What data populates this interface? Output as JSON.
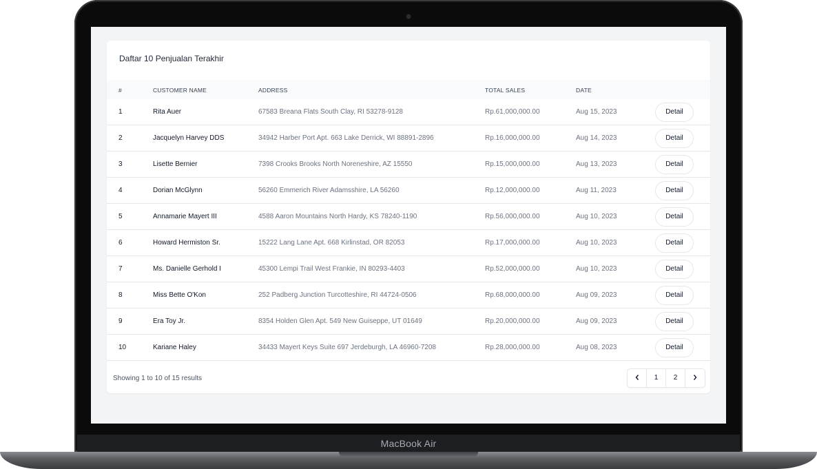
{
  "device": {
    "brand_label": "MacBook Air"
  },
  "card": {
    "title": "Daftar 10 Penjualan Terakhir"
  },
  "table": {
    "headers": {
      "no": "#",
      "name": "CUSTOMER NAME",
      "address": "ADDRESS",
      "sales": "TOTAL SALES",
      "date": "DATE"
    },
    "action_label": "Detail",
    "rows": [
      {
        "no": "1",
        "name": "Rita Auer",
        "address": "67583 Breana Flats South Clay, RI 53278-9128",
        "sales": "Rp.61,000,000.00",
        "date": "Aug 15, 2023"
      },
      {
        "no": "2",
        "name": "Jacquelyn Harvey DDS",
        "address": "34942 Harber Port Apt. 663 Lake Derrick, WI 88891-2896",
        "sales": "Rp.16,000,000.00",
        "date": "Aug 14, 2023"
      },
      {
        "no": "3",
        "name": "Lisette Bernier",
        "address": "7398 Crooks Brooks North Noreneshire, AZ 15550",
        "sales": "Rp.15,000,000.00",
        "date": "Aug 13, 2023"
      },
      {
        "no": "4",
        "name": "Dorian McGlynn",
        "address": "56260 Emmerich River Adamsshire, LA 56260",
        "sales": "Rp.12,000,000.00",
        "date": "Aug 11, 2023"
      },
      {
        "no": "5",
        "name": "Annamarie Mayert III",
        "address": "4588 Aaron Mountains North Hardy, KS 78240-1190",
        "sales": "Rp.56,000,000.00",
        "date": "Aug 10, 2023"
      },
      {
        "no": "6",
        "name": "Howard Hermiston Sr.",
        "address": "15222 Lang Lane Apt. 668 Kirlinstad, OR 82053",
        "sales": "Rp.17,000,000.00",
        "date": "Aug 10, 2023"
      },
      {
        "no": "7",
        "name": "Ms. Danielle Gerhold I",
        "address": "45300 Lempi Trail West Frankie, IN 80293-4403",
        "sales": "Rp.52,000,000.00",
        "date": "Aug 10, 2023"
      },
      {
        "no": "8",
        "name": "Miss Bette O'Kon",
        "address": "252 Padberg Junction Turcotteshire, RI 44724-0506",
        "sales": "Rp.68,000,000.00",
        "date": "Aug 09, 2023"
      },
      {
        "no": "9",
        "name": "Era Toy Jr.",
        "address": "8354 Holden Glen Apt. 549 New Guiseppe, UT 01649",
        "sales": "Rp.20,000,000.00",
        "date": "Aug 09, 2023"
      },
      {
        "no": "10",
        "name": "Kariane Haley",
        "address": "34433 Mayert Keys Suite 697 Jerdeburgh, LA 46960-7208",
        "sales": "Rp.28,000,000.00",
        "date": "Aug 08, 2023"
      }
    ]
  },
  "footer": {
    "results_text": "Showing 1 to 10 of 15 results",
    "pages": [
      "1",
      "2"
    ],
    "prev_icon": "chevron-left-icon",
    "next_icon": "chevron-right-icon"
  }
}
